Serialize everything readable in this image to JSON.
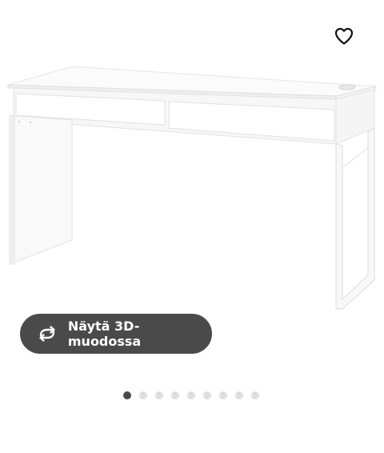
{
  "product": {
    "image_alt": "White desk with two drawers"
  },
  "favorite": {
    "icon": "heart-outline-icon"
  },
  "view_3d": {
    "label": "Näytä 3D-muodossa",
    "icon": "rotate-arrows-icon"
  },
  "carousel": {
    "total": 9,
    "active_index": 0
  },
  "colors": {
    "button_bg": "#4a4a4a",
    "dot_active": "#4a4a4a",
    "dot_inactive": "#dfdfdf"
  }
}
